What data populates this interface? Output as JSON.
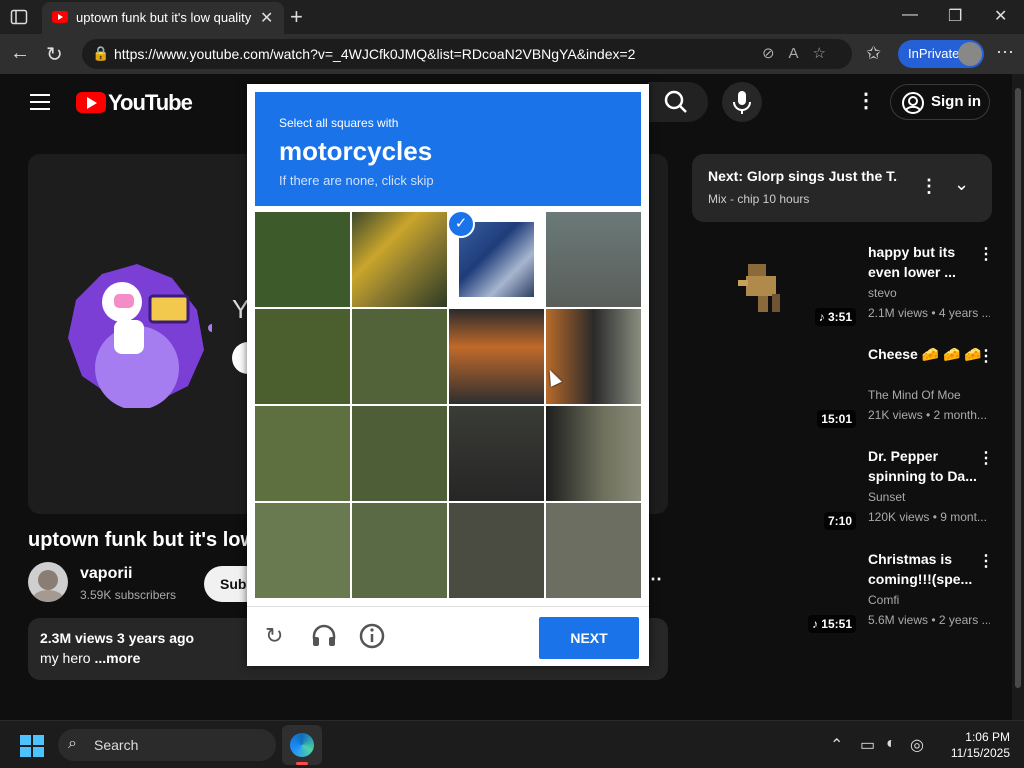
{
  "browser": {
    "tab_title": "uptown funk but it's low quality",
    "url": "https://www.youtube.com/watch?v=_4WJCfk0JMQ&list=RDcoaN2VBNgYA&index=2",
    "inprivate_label": "InPrivate"
  },
  "youtube": {
    "wordmark": "YouTube",
    "signin_label": "Sign in",
    "player_letter": "Y",
    "video_title": "uptown funk but it's low q",
    "channel_name": "vaporii",
    "channel_subs": "3.59K subscribers",
    "subscribe_label": "Subs",
    "description_stats": "2.3M views  3 years ago",
    "description_text": "my hero ",
    "description_more": "...more",
    "next": {
      "title": "Next: Glorp sings Just the T...",
      "subtitle": "Mix - chip 10 hours"
    },
    "recommendations": [
      {
        "title": "happy but its even lower ...",
        "channel": "stevo",
        "meta": "2.1M views • 4 years ...",
        "duration": "♪ 3:51"
      },
      {
        "title": "Cheese 🧀 🧀 🧀",
        "channel": "The Mind Of Moe",
        "meta": "21K views • 2 month...",
        "duration": "15:01"
      },
      {
        "title": "Dr. Pepper spinning to Da...",
        "channel": "Sunset",
        "meta": "120K views • 9 mont...",
        "duration": "7:10"
      },
      {
        "title": "Christmas is coming!!!(spe...",
        "channel": "Comfi",
        "meta": "5.6M views • 2 years ...",
        "duration": "♪ 15:51"
      }
    ]
  },
  "captcha": {
    "instruction": "Select all squares with",
    "target": "motorcycles",
    "skip_hint": "If there are none, click skip",
    "next_label": "NEXT",
    "selected_tiles": [
      2
    ],
    "accent_color": "#1a73e8"
  },
  "taskbar": {
    "search_label": "Search",
    "time": "1:06 PM",
    "date": "11/15/2025"
  }
}
